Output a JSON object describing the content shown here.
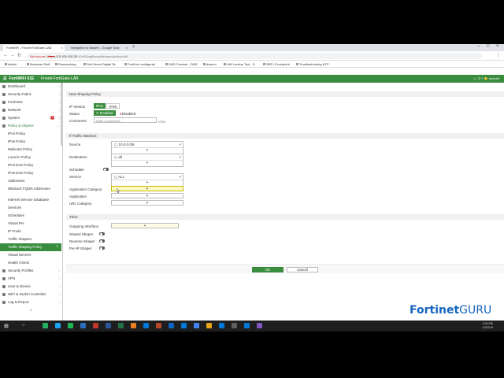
{
  "browser": {
    "tabs": [
      {
        "label": "FortiWiFi - Fnoeti FortiGate-LAB",
        "active": true
      },
      {
        "label": "integrated to fabdert - Google Sear",
        "active": false
      }
    ],
    "url": {
      "warning": "Not secure",
      "scheme": "https",
      "rest": "://10.100.100.20",
      "path": ":10443/ng/firewall/shaper/policy/edit"
    },
    "bookmarks": [
      "Admin",
      "Business Stuff",
      "Researching",
      "Self-Serve Digital Sk",
      "FortiLink configurati",
      "DNS Checker - DNS",
      "draw.io",
      "HW Lookup Tool - D",
      "SRP | Proofpoint",
      "Troubleshooting NTP"
    ]
  },
  "header": {
    "product": "FortiWiFi 61E",
    "hostname": "Fnoeti-FortiGate-LAB",
    "user": "mprueil"
  },
  "sidebar": {
    "items": [
      {
        "label": "Dashboard",
        "kind": "top"
      },
      {
        "label": "Security Fabric",
        "kind": "top"
      },
      {
        "label": "FortiView",
        "kind": "top"
      },
      {
        "label": "Network",
        "kind": "top"
      },
      {
        "label": "System",
        "kind": "top",
        "badge": "1"
      },
      {
        "label": "Policy & Objects",
        "kind": "top-open"
      },
      {
        "label": "IPv4 Policy",
        "kind": "sub"
      },
      {
        "label": "IPv6 Policy",
        "kind": "sub"
      },
      {
        "label": "Multicast Policy",
        "kind": "sub"
      },
      {
        "label": "Local In Policy",
        "kind": "sub"
      },
      {
        "label": "IPv4 DoS Policy",
        "kind": "sub"
      },
      {
        "label": "IPv6 DoS Policy",
        "kind": "sub"
      },
      {
        "label": "Addresses",
        "kind": "sub"
      },
      {
        "label": "Wildcard FQDN Addresses",
        "kind": "sub2"
      },
      {
        "label": "Internet Service Database",
        "kind": "sub"
      },
      {
        "label": "Services",
        "kind": "sub"
      },
      {
        "label": "Schedules",
        "kind": "sub"
      },
      {
        "label": "Virtual IPs",
        "kind": "sub"
      },
      {
        "label": "IP Pools",
        "kind": "sub"
      },
      {
        "label": "Traffic Shapers",
        "kind": "sub"
      },
      {
        "label": "Traffic Shaping Policy",
        "kind": "active"
      },
      {
        "label": "Virtual Servers",
        "kind": "sub"
      },
      {
        "label": "Health Check",
        "kind": "sub"
      },
      {
        "label": "Security Profiles",
        "kind": "top"
      },
      {
        "label": "VPN",
        "kind": "top"
      },
      {
        "label": "User & Device",
        "kind": "top"
      },
      {
        "label": "WiFi & Switch Controller",
        "kind": "top"
      },
      {
        "label": "Log & Report",
        "kind": "top"
      }
    ]
  },
  "form": {
    "section_title": "New Shaping Policy",
    "ip_version_label": "IP Version",
    "ipv4": "IPv4",
    "ipv6": "IPv6",
    "status_label": "Status",
    "enabled": "Enabled",
    "disabled": "Disabled",
    "comments_label": "Comments",
    "comments_placeholder": "Write a comment...",
    "comments_count": "0/255",
    "match_title": "If Traffic Matches:",
    "source_label": "Source",
    "source_value": "10.0.0.0/8",
    "destination_label": "Destination",
    "destination_value": "all",
    "schedule_label": "Schedule",
    "service_label": "Service",
    "service_value": "ALL",
    "app_category_label": "Application Category",
    "application_label": "Application",
    "url_category_label": "URL Category",
    "then_title": "Then:",
    "outgoing_label": "Outgoing Interface",
    "shared_label": "Shared Shaper",
    "reverse_label": "Reverse Shaper",
    "perip_label": "Per-IP Shaper",
    "add_symbol": "+",
    "remove_symbol": "×",
    "ok": "OK",
    "cancel": "Cancel"
  },
  "watermark": {
    "brand": "Fortinet",
    "suffix": "GURU"
  },
  "taskbar": {
    "time": "3:09 PM",
    "date": "1/1/2019"
  }
}
